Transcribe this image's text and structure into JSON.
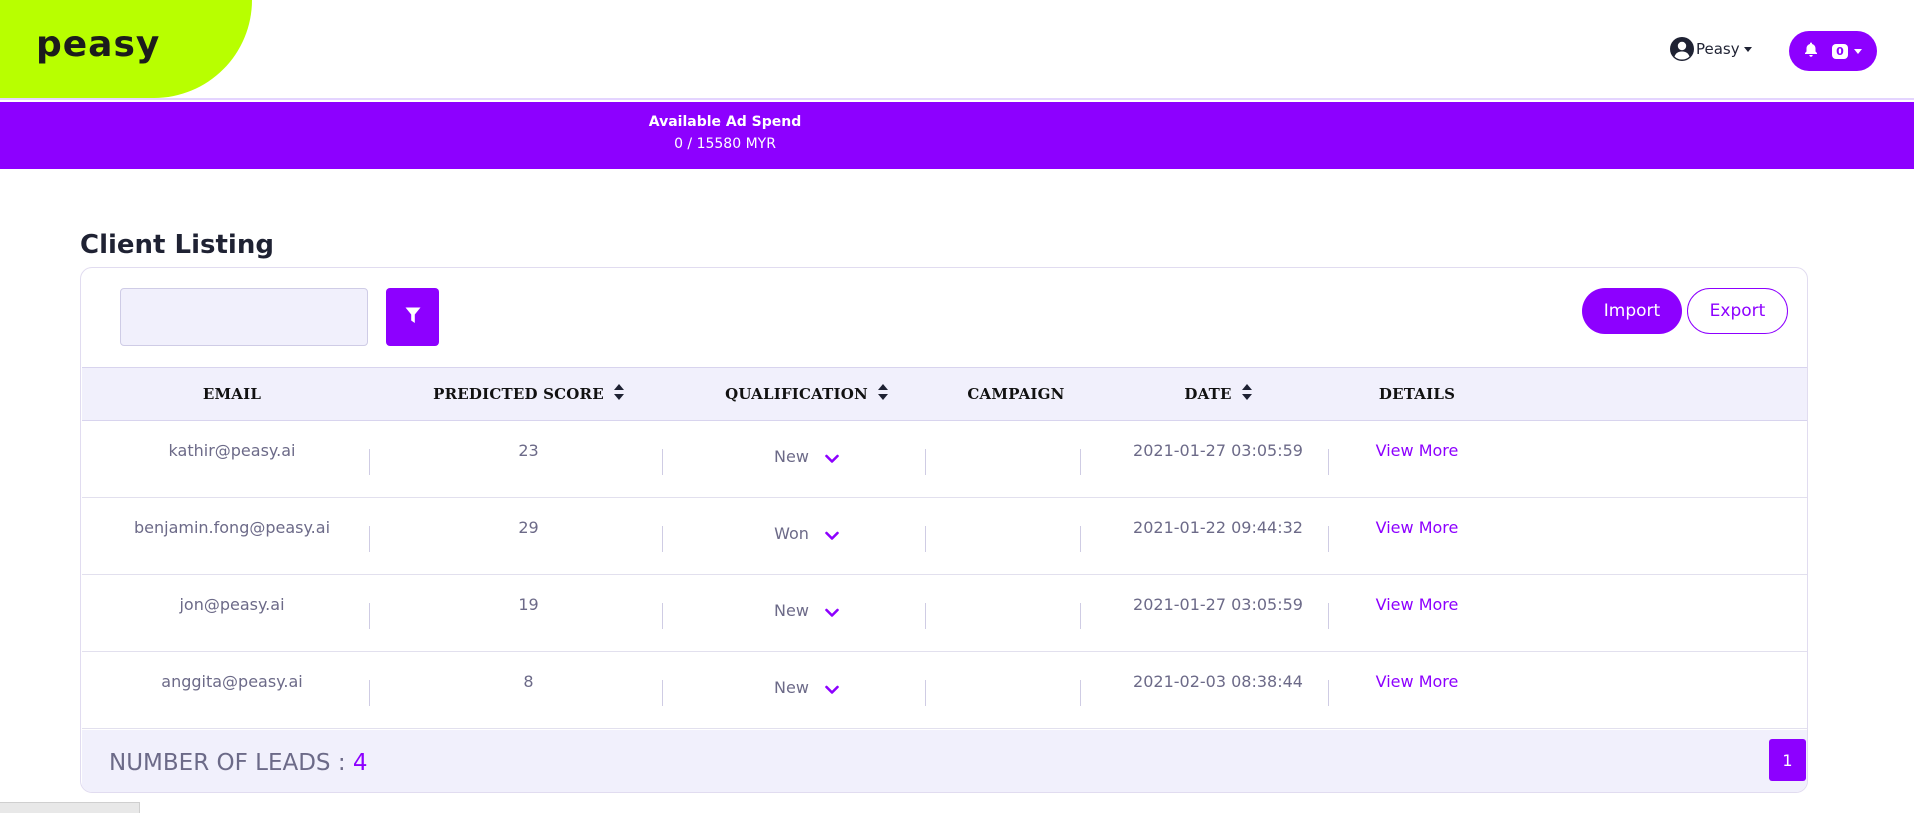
{
  "header": {
    "logo": "peasy",
    "user_name": "Peasy",
    "notification_count": "0",
    "icons": {
      "user": "user-circle-icon",
      "bell": "bell-icon"
    }
  },
  "banner": {
    "title": "Available Ad Spend",
    "value": "0 / 15580 MYR"
  },
  "page": {
    "title": "Client Listing"
  },
  "toolbar": {
    "search_value": "",
    "search_placeholder": "",
    "import_label": "Import",
    "export_label": "Export"
  },
  "table": {
    "columns": [
      "EMAIL",
      "PREDICTED SCORE",
      "QUALIFICATION",
      "CAMPAIGN",
      "DATE",
      "DETAILS"
    ],
    "rows": [
      {
        "email": "kathir@peasy.ai",
        "score": "23",
        "qualification": "New",
        "campaign": "",
        "date": "2021-01-27 03:05:59",
        "details": "View More"
      },
      {
        "email": "benjamin.fong@peasy.ai",
        "score": "29",
        "qualification": "Won",
        "campaign": "",
        "date": "2021-01-22 09:44:32",
        "details": "View More"
      },
      {
        "email": "jon@peasy.ai",
        "score": "19",
        "qualification": "New",
        "campaign": "",
        "date": "2021-01-27 03:05:59",
        "details": "View More"
      },
      {
        "email": "anggita@peasy.ai",
        "score": "8",
        "qualification": "New",
        "campaign": "",
        "date": "2021-02-03 08:38:44",
        "details": "View More"
      }
    ]
  },
  "footer": {
    "leads_label": "NUMBER OF LEADS : ",
    "leads_count": "4",
    "current_page": "1"
  },
  "colors": {
    "accent": "#8d00ff",
    "brand_green": "#b8ff00",
    "header_bg": "#f1f0fc"
  }
}
